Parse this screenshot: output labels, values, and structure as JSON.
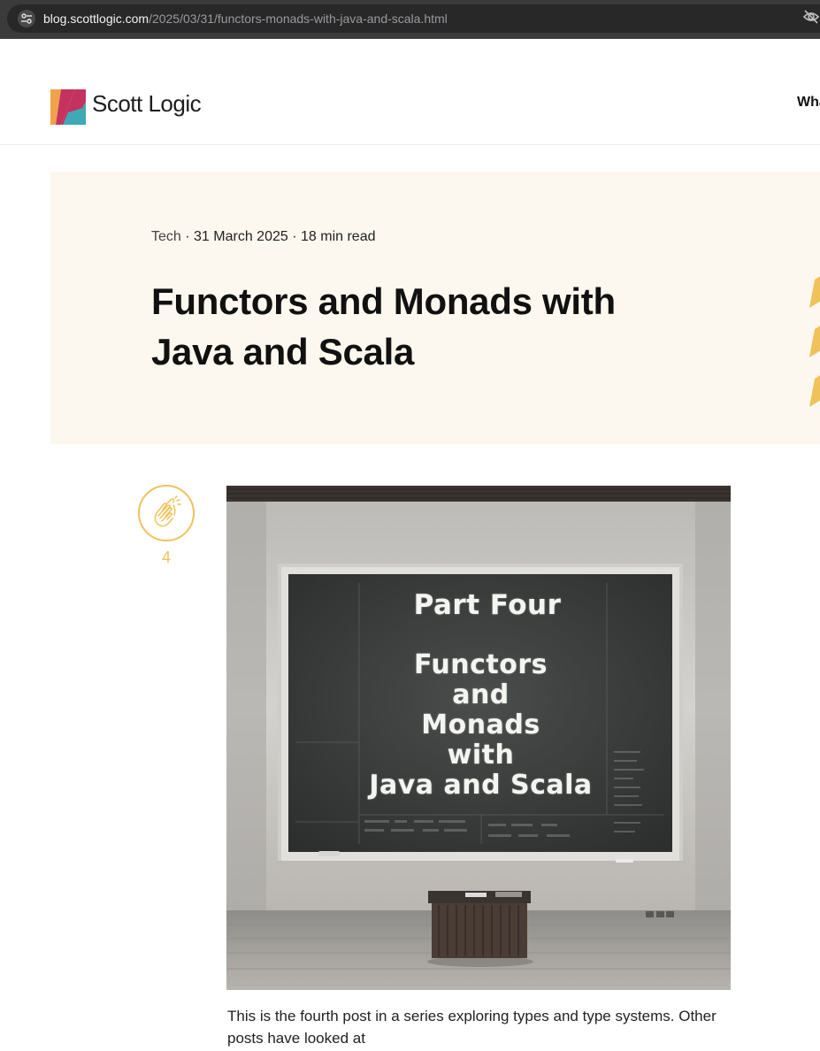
{
  "browser": {
    "url_host": "blog.scottlogic.com",
    "url_path": "/2025/03/31/functors-monads-with-java-and-scala.html",
    "site_settings_icon": "tune-icon",
    "privacy_icon": "eye-slash-icon"
  },
  "header": {
    "logo_text": "Scott Logic",
    "nav_partial": "Wha"
  },
  "article": {
    "category": "Tech",
    "date": "31 March 2025",
    "read_time": "18 min read",
    "separator": "·",
    "title": "Functors and Monads with Java and Scala",
    "claps": "4",
    "image": {
      "board_lines": [
        "Part Four",
        "Functors",
        "and",
        "Monads",
        "with",
        "Java and Scala"
      ]
    },
    "intro": "This is the fourth post in a series exploring types and type systems. Other posts have looked at"
  },
  "colors": {
    "accent": "#f0c25a",
    "hero_bg": "#fcf8ef",
    "logo_pink": "#c4325f",
    "logo_teal": "#3fa9b5",
    "logo_orange": "#f0a24a"
  }
}
